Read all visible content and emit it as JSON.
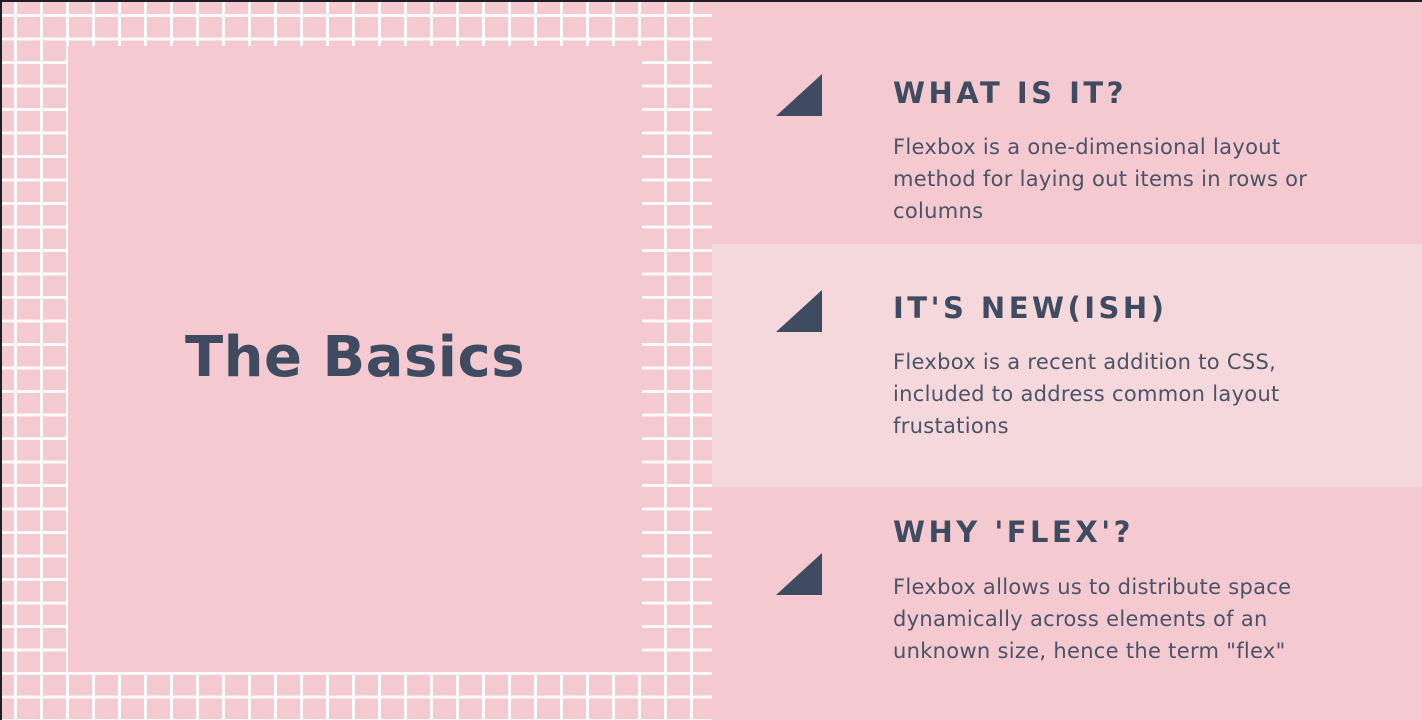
{
  "title": "The Basics",
  "sections": [
    {
      "heading": "WHAT IS IT?",
      "body": "Flexbox is a one-dimensional layout method for laying out items in rows or columns"
    },
    {
      "heading": "IT'S NEW(ISH)",
      "body": "Flexbox is a recent addition to CSS, included to address common layout frustations"
    },
    {
      "heading": "WHY 'FLEX'?",
      "body": "Flexbox allows us to distribute space dynamically across elements of an unknown size, hence the term \"flex\""
    }
  ],
  "colors": {
    "background": "#f4c9cf",
    "highlight_band": "#f5d8dc",
    "accent": "#3f4b61",
    "grid_lines": "#ffffff"
  },
  "icons": [
    "triangle-icon",
    "triangle-icon",
    "triangle-icon"
  ]
}
